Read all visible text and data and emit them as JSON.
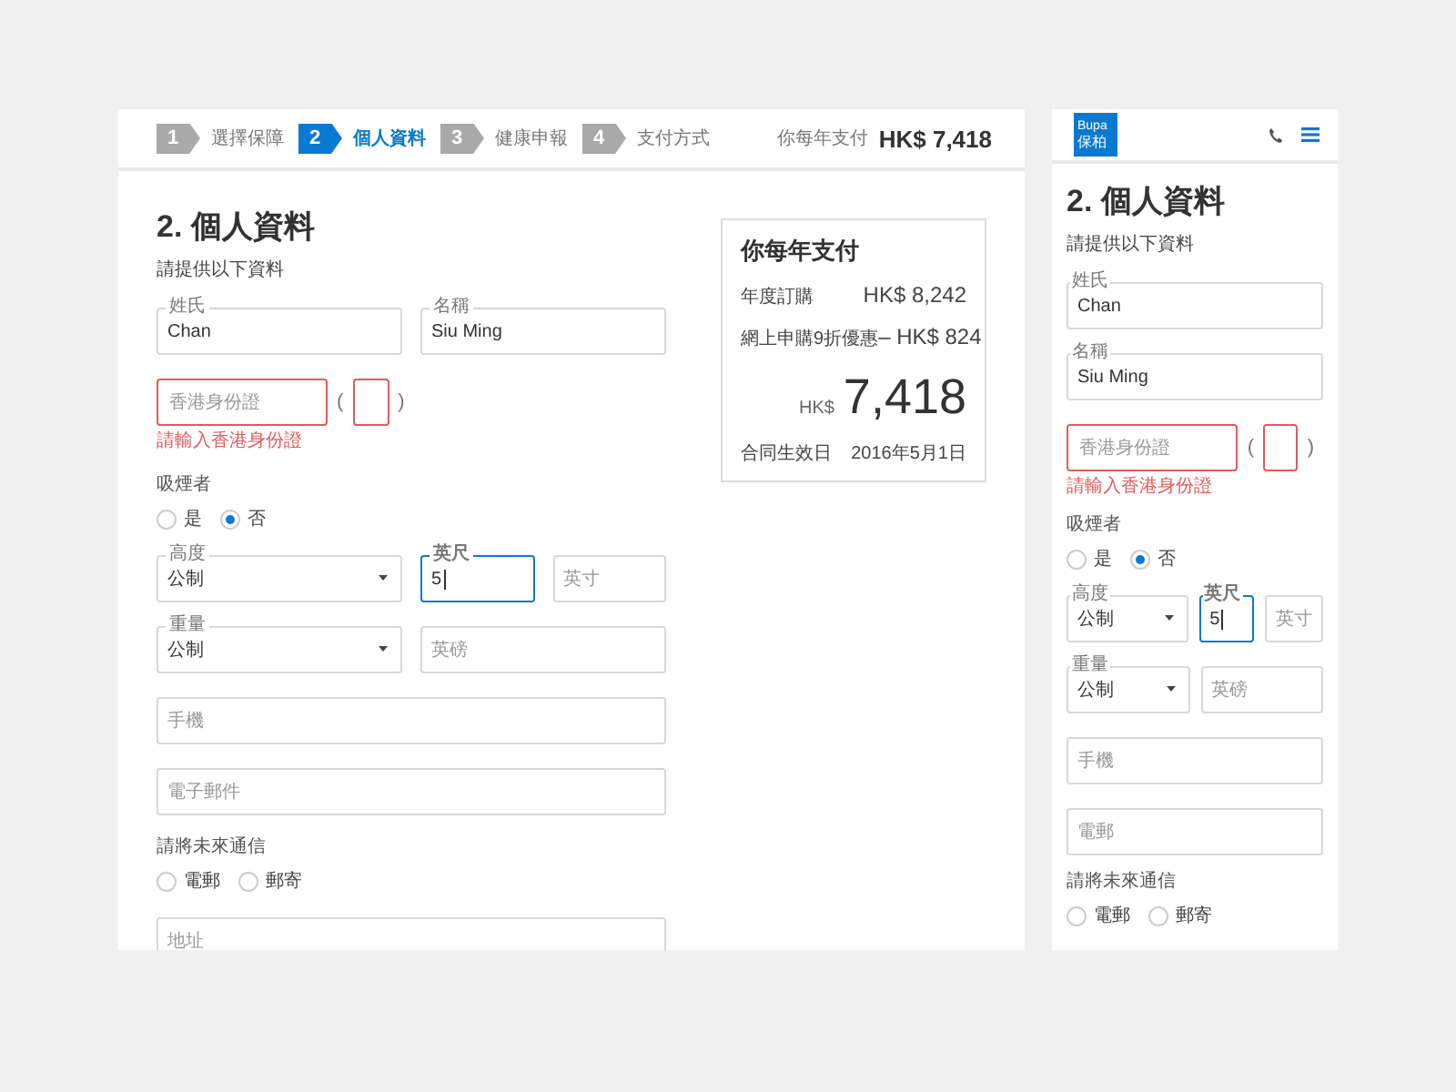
{
  "desktop": {
    "steps": [
      {
        "number": "1",
        "label": "選擇保障",
        "selected": false
      },
      {
        "number": "2",
        "label": "個人資料",
        "selected": true
      },
      {
        "number": "3",
        "label": "健康申報",
        "selected": false
      },
      {
        "number": "4",
        "label": "支付方式",
        "selected": false
      }
    ],
    "header_total": {
      "label": "你每年支付",
      "amount": "HK$ 7,418"
    },
    "form": {
      "title": "2. 個人資料",
      "subtitle": "請提供以下資料",
      "rows": [
        {
          "kind": "fields",
          "fields": [
            {
              "kind": "text",
              "label": "姓氏",
              "value": "Chan",
              "focused": false
            },
            {
              "kind": "text",
              "label": "名稱",
              "value": "Siu Ming",
              "focused": false
            }
          ]
        },
        {
          "kind": "id",
          "placeholder": "香港身份證",
          "invalid": true,
          "open": "(",
          "close": ")",
          "error": "請輸入香港身份證"
        },
        {
          "kind": "radio",
          "label": "吸煙者",
          "options": [
            {
              "label": "是",
              "selected": false
            },
            {
              "label": "否",
              "selected": true
            }
          ]
        },
        {
          "kind": "fields",
          "fields": [
            {
              "kind": "select",
              "label": "高度",
              "value": "公制",
              "focused": false
            },
            {
              "kind": "text",
              "label": "英尺",
              "value": "5",
              "focused": true
            },
            {
              "kind": "text",
              "placeholder": "英寸",
              "focused": false
            }
          ]
        },
        {
          "kind": "fields",
          "fields": [
            {
              "kind": "select",
              "label": "重量",
              "value": "公制",
              "focused": false
            },
            {
              "kind": "text",
              "placeholder": "英磅",
              "focused": false
            }
          ]
        },
        {
          "kind": "fields",
          "fields": [
            {
              "kind": "text",
              "placeholder": "手機",
              "focused": false
            }
          ]
        },
        {
          "kind": "fields",
          "fields": [
            {
              "kind": "text",
              "placeholder": "電子郵件",
              "focused": false
            }
          ]
        },
        {
          "kind": "radio",
          "label": "請將未來通信",
          "options": [
            {
              "label": "電郵",
              "selected": false
            },
            {
              "label": "郵寄",
              "selected": false
            }
          ]
        },
        {
          "kind": "fields",
          "fields": [
            {
              "kind": "text",
              "placeholder": "地址",
              "focused": false
            }
          ]
        }
      ]
    },
    "summary": {
      "title": "你每年支付",
      "lines": [
        {
          "label": "年度訂購",
          "value": "HK$ 8,242"
        },
        {
          "label": "網上申購9折優惠",
          "value": "– HK$ 824"
        }
      ],
      "total": {
        "currency": "HK$",
        "amount": "7,418"
      },
      "footer": {
        "label": "合同生效日",
        "value": "2016年5月1日"
      }
    }
  },
  "mobile": {
    "logo": {
      "name": "Bupa",
      "name_local": "保柏"
    },
    "form": {
      "title": "2. 個人資料",
      "subtitle": "請提供以下資料",
      "rows": [
        {
          "kind": "fields",
          "fields": [
            {
              "kind": "text",
              "label": "姓氏",
              "value": "Chan",
              "focused": false
            }
          ]
        },
        {
          "kind": "fields",
          "fields": [
            {
              "kind": "text",
              "label": "名稱",
              "value": "Siu Ming",
              "focused": false
            }
          ]
        },
        {
          "kind": "id",
          "placeholder": "香港身份證",
          "invalid": true,
          "open": "(",
          "close": ")",
          "error": "請輸入香港身份證"
        },
        {
          "kind": "radio",
          "label": "吸煙者",
          "options": [
            {
              "label": "是",
              "selected": false
            },
            {
              "label": "否",
              "selected": true
            }
          ]
        },
        {
          "kind": "fields",
          "fields": [
            {
              "kind": "select",
              "label": "高度",
              "value": "公制",
              "focused": false
            },
            {
              "kind": "text",
              "label": "英尺",
              "value": "5",
              "focused": true
            },
            {
              "kind": "text",
              "placeholder": "英寸",
              "focused": false
            }
          ]
        },
        {
          "kind": "fields",
          "fields": [
            {
              "kind": "select",
              "label": "重量",
              "value": "公制",
              "focused": false
            },
            {
              "kind": "text",
              "placeholder": "英磅",
              "focused": false
            }
          ]
        },
        {
          "kind": "fields",
          "fields": [
            {
              "kind": "text",
              "placeholder": "手機",
              "focused": false
            }
          ]
        },
        {
          "kind": "fields",
          "fields": [
            {
              "kind": "text",
              "placeholder": "電郵",
              "focused": false
            }
          ]
        },
        {
          "kind": "radio",
          "label": "請將未來通信",
          "options": [
            {
              "label": "電郵",
              "selected": false
            },
            {
              "label": "郵寄",
              "selected": false
            }
          ]
        }
      ]
    }
  }
}
